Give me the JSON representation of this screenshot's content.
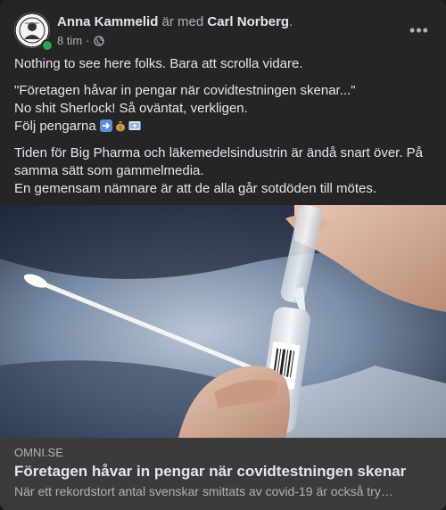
{
  "post": {
    "author": "Anna Kammelid",
    "with_word": "är med",
    "tagged": "Carl Norberg",
    "period": ".",
    "time": "8 tim",
    "separator": "·",
    "privacy_icon": "globe-icon",
    "more_icon": "more-options-icon",
    "more_label": "•••",
    "online_color": "#31a24c",
    "lines": {
      "p1": "Nothing to see here folks. Bara att scrolla vidare.",
      "p2_l1": "\"Företagen håvar in pengar när covidtestningen skenar...\"",
      "p2_l2": "No shit Sherlock! Så oväntat, verkligen.",
      "p2_l3": "Följ pengarna",
      "p3_l1": "Tiden för Big Pharma och läkemedelsindustrin är ändå snart över. På",
      "p3_l2": "samma sätt som gammelmedia.",
      "p3_l3": "En gemensam nämnare är att de alla går sotdöden till mötes."
    },
    "emojis": [
      "arrow-right-icon",
      "money-bag-icon",
      "money-icon"
    ]
  },
  "link": {
    "domain": "OMNI.SE",
    "title": "Företagen håvar in pengar när covidtestningen skenar",
    "description": "När ett rekordstort antal svenskar smittats av covid-19 är också try…"
  }
}
